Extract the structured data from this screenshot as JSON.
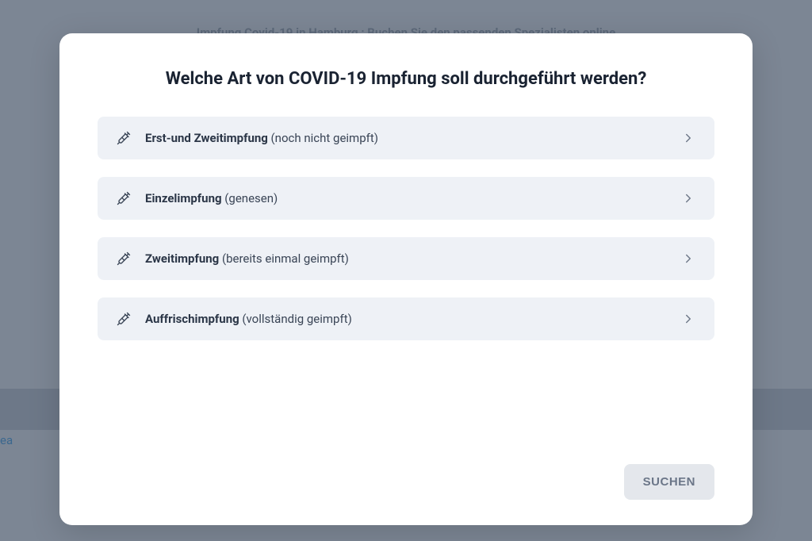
{
  "backdrop": {
    "title": "Impfung Covid-19 in Hamburg : Buchen Sie den passenden Spezialisten online",
    "link_fragment": "ea"
  },
  "modal": {
    "title": "Welche Art von COVID-19 Impfung soll durchgeführt werden?",
    "options": [
      {
        "bold": "Erst-und Zweitimpfung",
        "detail": " (noch nicht geimpft)"
      },
      {
        "bold": "Einzelimpfung",
        "detail": " (genesen)"
      },
      {
        "bold": "Zweitimpfung",
        "detail": " (bereits einmal geimpft)"
      },
      {
        "bold": "Auffrischimpfung",
        "detail": " (vollständig geimpft)"
      }
    ],
    "search_label": "SUCHEN"
  }
}
